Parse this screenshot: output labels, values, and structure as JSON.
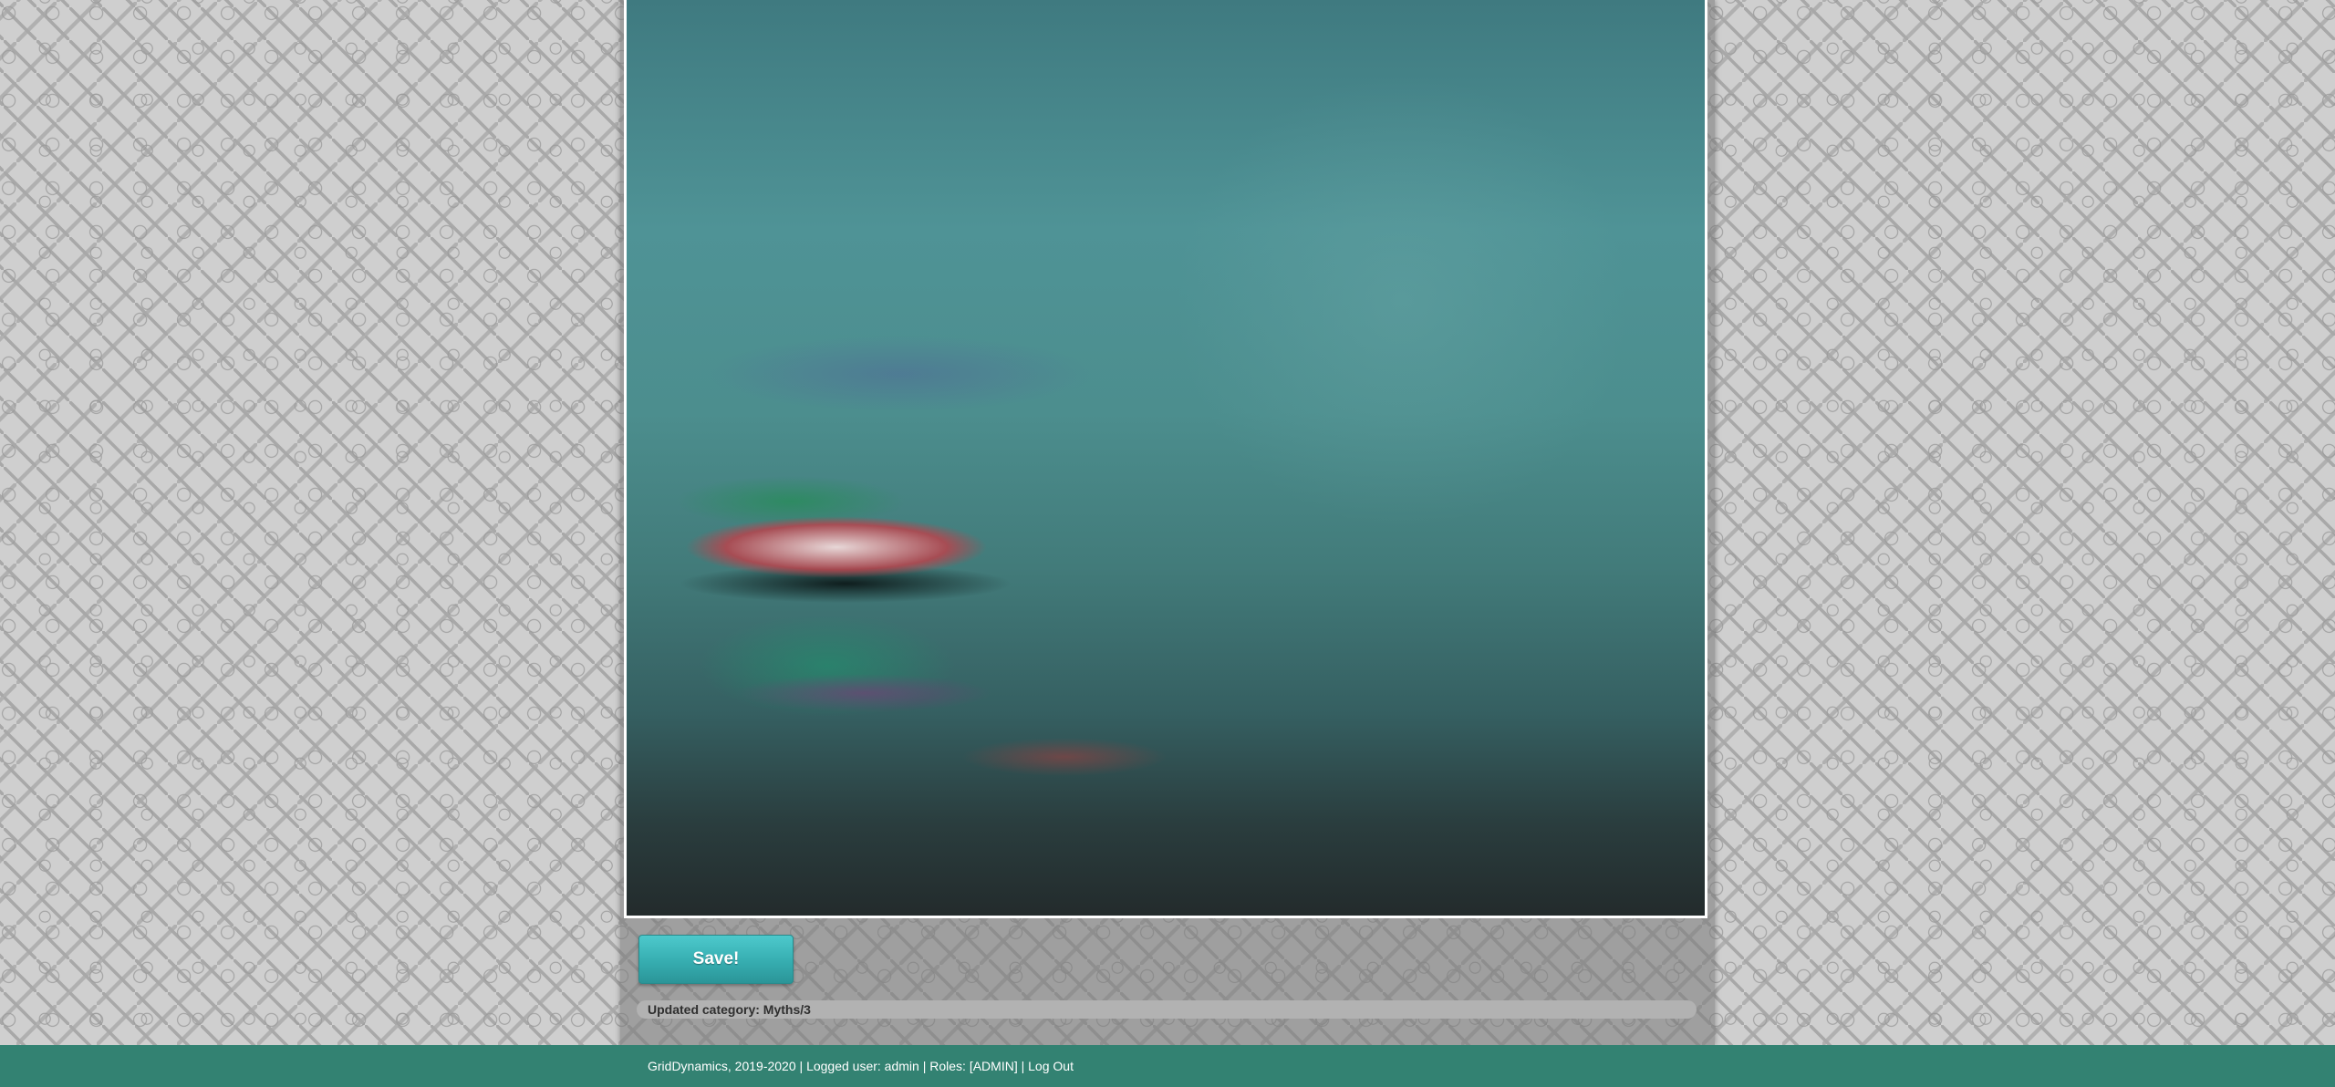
{
  "main": {
    "save_label": "Save!",
    "status_message": "Updated category: Myths/3"
  },
  "footer": {
    "copyright": "GridDynamics, 2019-2020",
    "separator": " | ",
    "logged_user": "Logged user: admin",
    "roles": "Roles: [ADMIN]",
    "logout_label": "Log Out"
  },
  "colors": {
    "footer_bg": "#338272",
    "button_accent": "#3ab5b8",
    "status_bar_bg": "#b2b2b2"
  }
}
